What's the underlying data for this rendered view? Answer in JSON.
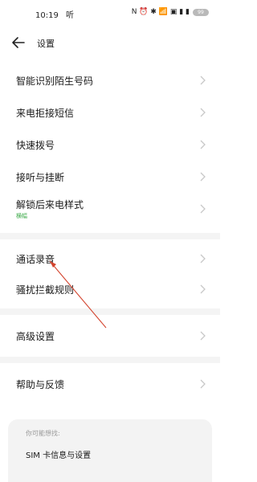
{
  "status_bar": {
    "time": "10:19",
    "extra": "听",
    "icons": "N ⏰ ✱ 📶 ▣ ▮ ▮",
    "battery": "99"
  },
  "header": {
    "title": "设置"
  },
  "menu": [
    {
      "label": "智能识别陌生号码"
    },
    {
      "label": "来电拒接短信"
    },
    {
      "label": "快速拨号"
    },
    {
      "label": "接听与挂断"
    },
    {
      "label": "解锁后来电样式",
      "sub": "横幅"
    },
    {
      "label": "通话录音"
    },
    {
      "label": "骚扰拦截规则"
    },
    {
      "label": "高级设置"
    },
    {
      "label": "帮助与反馈"
    }
  ],
  "suggest": {
    "title": "你可能想找:",
    "item": "SIM 卡信息与设置"
  }
}
